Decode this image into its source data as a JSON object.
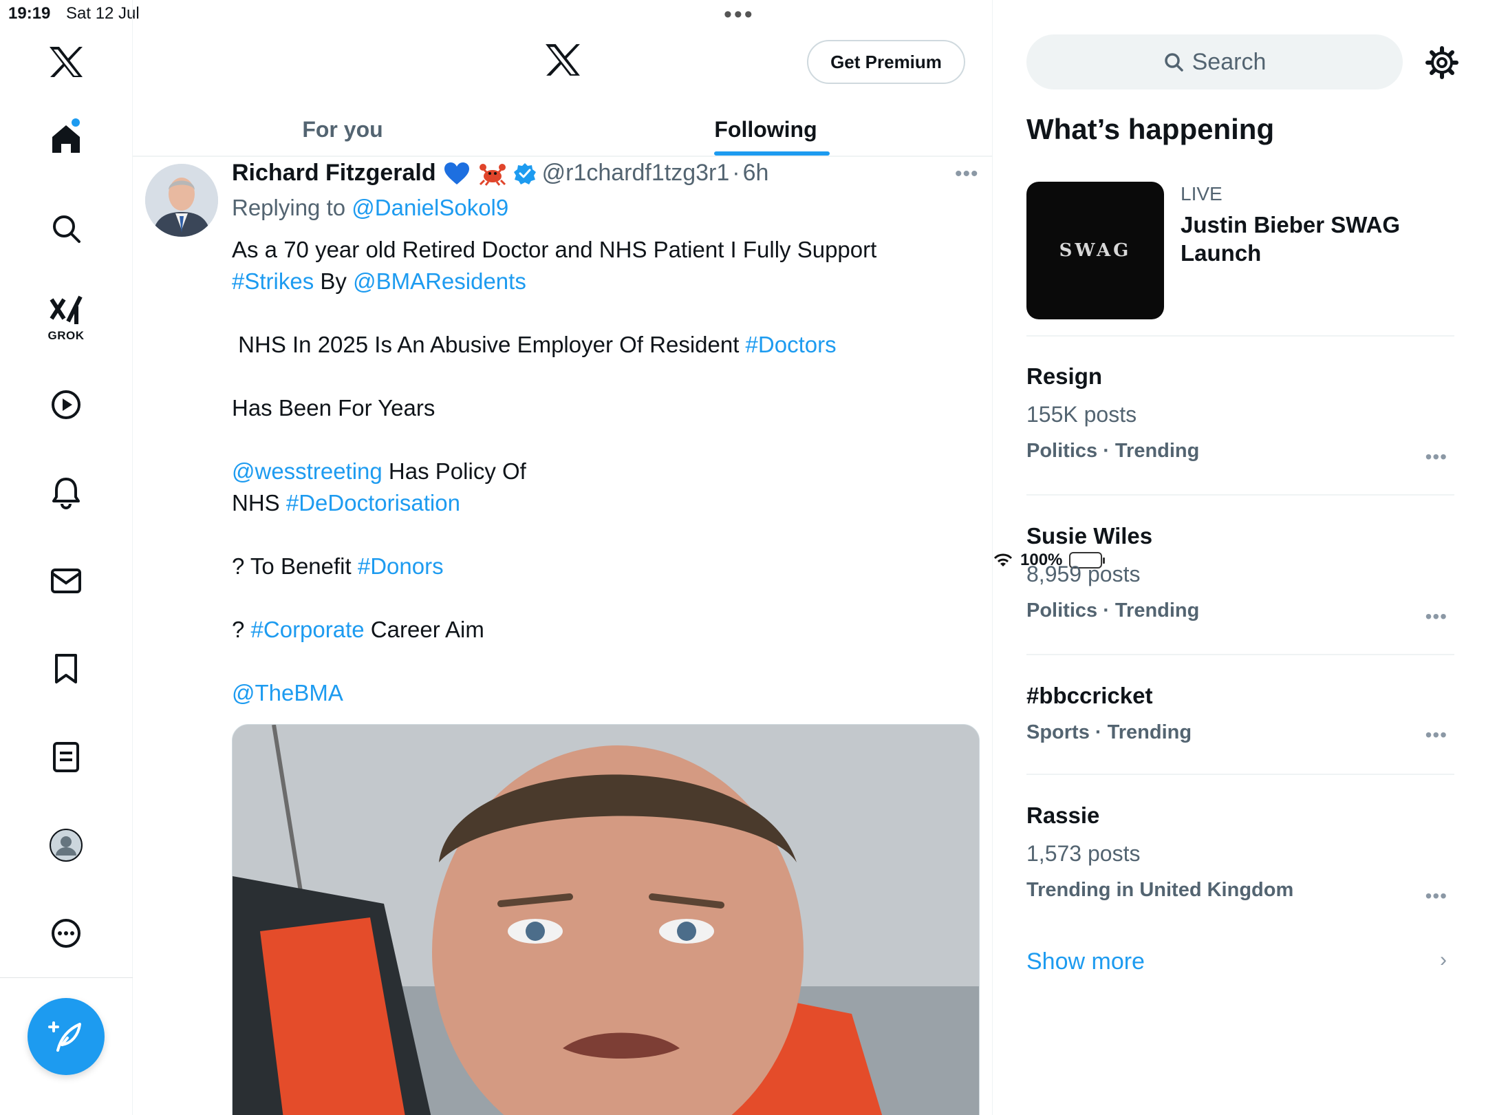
{
  "status_bar": {
    "time": "19:19",
    "date": "Sat 12 Jul",
    "battery": "100%"
  },
  "sidebar": {
    "items": [
      {
        "name": "x-logo-icon"
      },
      {
        "name": "home-icon"
      },
      {
        "name": "search-icon"
      },
      {
        "name": "grok-icon",
        "label": "GROK"
      },
      {
        "name": "video-icon"
      },
      {
        "name": "notifications-icon"
      },
      {
        "name": "messages-icon"
      },
      {
        "name": "bookmarks-icon"
      },
      {
        "name": "lists-icon"
      },
      {
        "name": "profile-icon"
      },
      {
        "name": "more-icon"
      }
    ],
    "compose_icon": "compose-icon",
    "accent": "#1d9bf0"
  },
  "header": {
    "premium_label": "Get Premium",
    "tabs": [
      {
        "label": "For you",
        "active": false
      },
      {
        "label": "Following",
        "active": true
      }
    ]
  },
  "tweet": {
    "author": "Richard Fitzgerald",
    "emojis": [
      "blue-heart-icon",
      "crab-icon"
    ],
    "handle": "@r1chardf1tzg3r1",
    "time": "6h",
    "replying_prefix": "Replying to",
    "replying_to": "@DanielSokol9",
    "lines": {
      "l1": "As a 70 year old Retired Doctor and NHS Patient I Fully Support",
      "l2a": "#Strikes",
      "l2b": " By ",
      "l2c": "@BMAResidents",
      "l3a": " NHS In 2025 Is An Abusive Employer Of Resident ",
      "l3b": "#Doctors",
      "l4": "Has Been For Years",
      "l5a": "@wesstreeting",
      "l5b": " Has Policy Of",
      "l6a": "NHS ",
      "l6b": "#DeDoctorisation",
      "l7a": "? To Benefit ",
      "l7b": "#Donors",
      "l8a": "? ",
      "l8b": "#Corporate",
      "l8c": " Career Aim",
      "l9": "@TheBMA"
    }
  },
  "right": {
    "search_placeholder": "Search",
    "section_title": "What’s happening",
    "live": {
      "label": "LIVE",
      "title": "Justin Bieber SWAG Launch",
      "thumb_text": "SWAG"
    },
    "trends": [
      {
        "title": "Resign",
        "count": "155K posts",
        "category": "Politics · Trending"
      },
      {
        "title": "Susie Wiles",
        "count": "8,959 posts",
        "category": "Politics · Trending"
      },
      {
        "title": "#bbccricket",
        "count": "",
        "category": "Sports · Trending"
      },
      {
        "title": "Rassie",
        "count": "1,573 posts",
        "category": "Trending in United Kingdom"
      }
    ],
    "show_more": "Show more"
  }
}
